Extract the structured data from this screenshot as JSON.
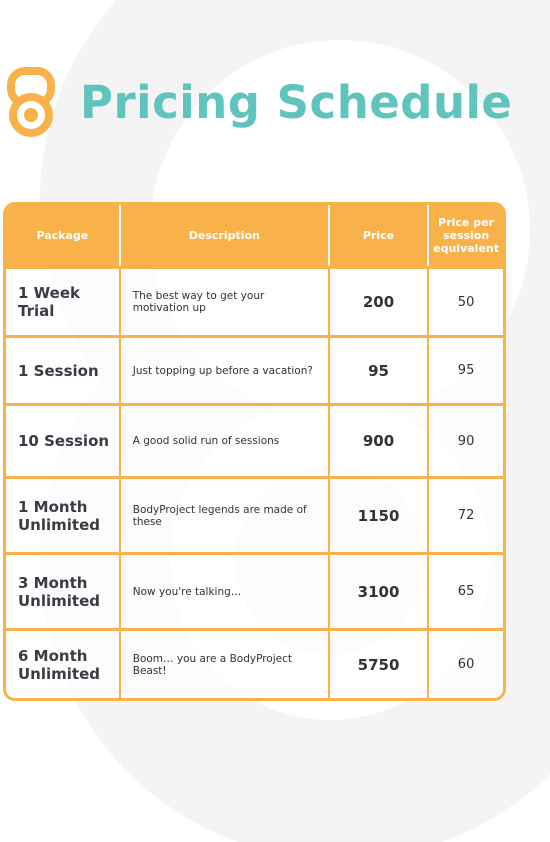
{
  "title": "Pricing Schedule",
  "colors": {
    "accent": "#f9b249",
    "title": "#5ec4bd",
    "background_shape": "#f4f4f4"
  },
  "logo_icon": "kettlebell-icon",
  "table": {
    "headers": [
      "Package",
      "Description",
      "Price",
      "Price per session equivalent"
    ],
    "rows": [
      {
        "package": "1 Week Trial",
        "description": "The best way to get your motivation up",
        "price": "200",
        "per_session": "50"
      },
      {
        "package": "1 Session",
        "description": "Just topping up before a vacation?",
        "price": "95",
        "per_session": "95"
      },
      {
        "package": "10 Session",
        "description": "A good solid run of sessions",
        "price": "900",
        "per_session": "90"
      },
      {
        "package": "1 Month Unlimited",
        "description": "BodyProject legends are made of these",
        "price": "1150",
        "per_session": "72"
      },
      {
        "package": "3 Month Unlimited",
        "description": "Now you're talking…",
        "price": "3100",
        "per_session": "65"
      },
      {
        "package": "6 Month Unlimited",
        "description": "Boom… you are a BodyProject Beast!",
        "price": "5750",
        "per_session": "60"
      }
    ]
  }
}
